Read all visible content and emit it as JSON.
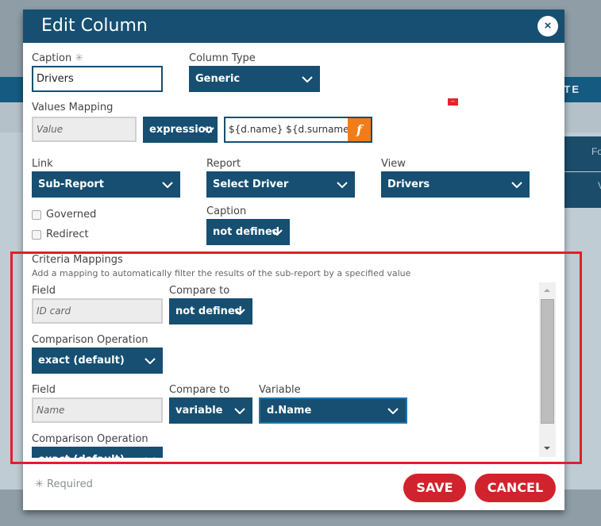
{
  "background": {
    "header_label": "TE",
    "side_items": [
      "Fo",
      "V"
    ]
  },
  "dialog": {
    "title": "Edit Column",
    "close_label": "×",
    "caption": {
      "label": "Caption",
      "required_mark": "✳",
      "value": "Drivers"
    },
    "column_type": {
      "label": "Column Type",
      "value": "Generic"
    },
    "values_mapping": {
      "label": "Values Mapping",
      "field_placeholder": "Value",
      "mode": "expression",
      "expression": "${d.name} ${d.surname}",
      "fx_label": "f"
    },
    "badge": "–",
    "link": {
      "label": "Link",
      "value": "Sub-Report"
    },
    "report": {
      "label": "Report",
      "value": "Select Driver"
    },
    "view": {
      "label": "View",
      "value": "Drivers"
    },
    "governed": {
      "label": "Governed",
      "checked": false
    },
    "redirect": {
      "label": "Redirect",
      "checked": false
    },
    "link_caption": {
      "label": "Caption",
      "value": "not defined"
    },
    "criteria": {
      "title": "Criteria Mappings",
      "description": "Add a mapping to automatically filter the results of the sub-report by a specified value",
      "mappings": [
        {
          "field_label": "Field",
          "field_value": "ID card",
          "compare_label": "Compare to",
          "compare_value": "not defined",
          "operation_label": "Comparison Operation",
          "operation_value": "exact (default)"
        },
        {
          "field_label": "Field",
          "field_value": "Name",
          "compare_label": "Compare to",
          "compare_value": "variable",
          "variable_label": "Variable",
          "variable_value": "d.Name",
          "operation_label": "Comparison Operation",
          "operation_value": "exact (default)"
        }
      ]
    },
    "footer": {
      "required_note": "✳ Required",
      "save_label": "SAVE",
      "cancel_label": "CANCEL"
    }
  },
  "colors": {
    "primary": "#164f72",
    "accent_orange": "#f07d1a",
    "button_red": "#d0232d",
    "highlight_red": "#e31e2a"
  }
}
